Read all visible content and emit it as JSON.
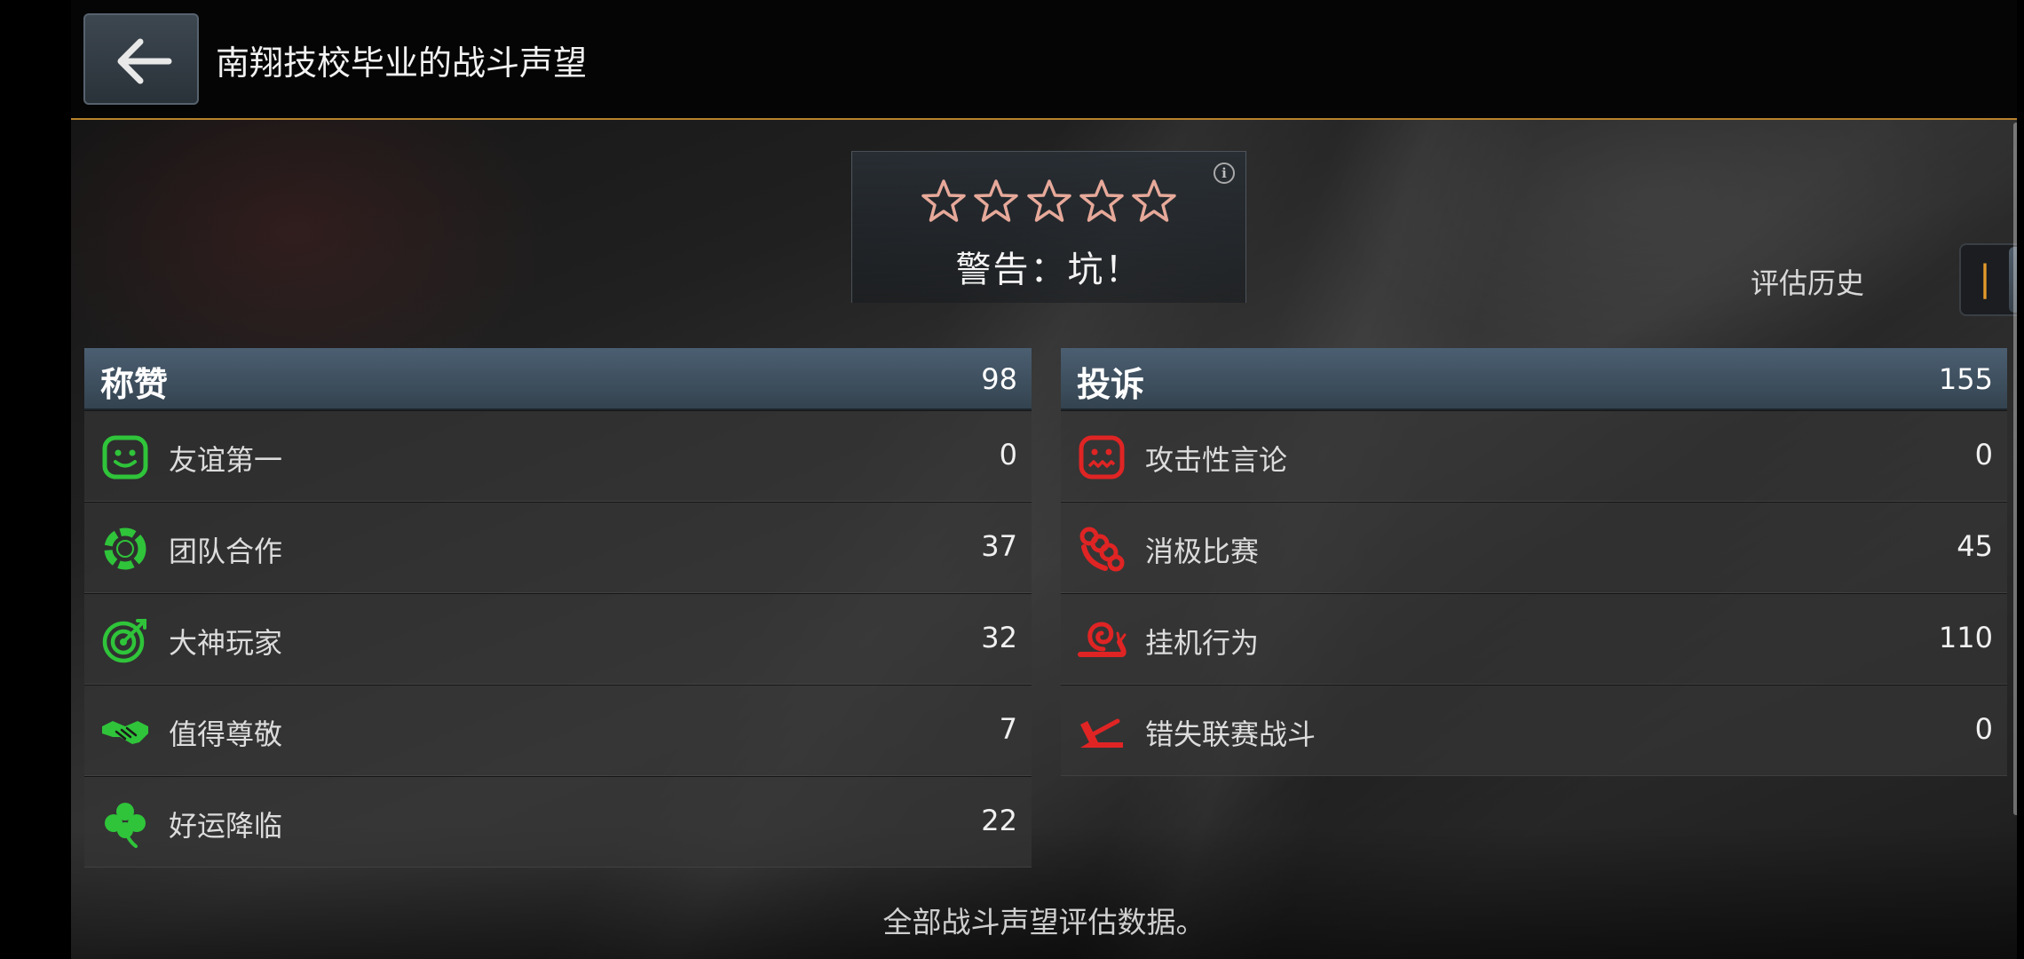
{
  "header": {
    "title": "南翔技校毕业的战斗声望"
  },
  "rating": {
    "stars_filled": 0,
    "stars_total": 5,
    "label": "警告：坑！"
  },
  "history": {
    "label": "评估历史"
  },
  "praise": {
    "title": "称赞",
    "total": "98",
    "items": [
      {
        "label": "友谊第一",
        "count": "0"
      },
      {
        "label": "团队合作",
        "count": "37"
      },
      {
        "label": "大神玩家",
        "count": "32"
      },
      {
        "label": "值得尊敬",
        "count": "7"
      },
      {
        "label": "好运降临",
        "count": "22"
      }
    ]
  },
  "complaints": {
    "title": "投诉",
    "total": "155",
    "items": [
      {
        "label": "攻击性言论",
        "count": "0"
      },
      {
        "label": "消极比赛",
        "count": "45"
      },
      {
        "label": "挂机行为",
        "count": "110"
      },
      {
        "label": "错失联赛战斗",
        "count": "0"
      }
    ]
  },
  "footer": {
    "text": "全部战斗声望评估数据。"
  },
  "colors": {
    "accent": "#b8832c",
    "praise_icon": "#2fc43a",
    "complaint_icon": "#e02424",
    "header_bar": "#45586a",
    "star_outline": "#e7a99a"
  },
  "icons": {
    "praise": [
      "smiley-face-icon",
      "teamwork-ring-icon",
      "target-icon",
      "handshake-icon",
      "clover-icon"
    ],
    "complaints": [
      "angry-face-icon",
      "brass-knuckles-icon",
      "snail-icon",
      "missed-battle-icon"
    ]
  }
}
